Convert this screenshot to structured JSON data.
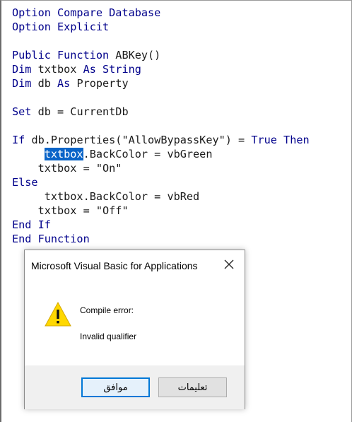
{
  "editor": {
    "lines": {
      "l1": {
        "kw1": "Option Compare Database"
      },
      "l2": {
        "kw1": "Option Explicit"
      },
      "l4": {
        "kw1": "Public Function",
        "rest": " ABKey()"
      },
      "l5": {
        "kw1": "Dim",
        "mid": " txtbox ",
        "kw2": "As String"
      },
      "l6": {
        "kw1": "Dim",
        "mid": " db ",
        "kw2": "As",
        "rest": " Property"
      },
      "l8": {
        "kw1": "Set",
        "rest": " db = CurrentDb"
      },
      "l10": {
        "kw1": "If",
        "mid": " db.Properties(\"AllowBypassKey\") = ",
        "kw2": "True Then"
      },
      "l11": {
        "indent": "     ",
        "sel": "txtbox",
        "rest": ".BackColor = vbGreen"
      },
      "l12": {
        "text": "    txtbox = \"On\""
      },
      "l13": {
        "kw1": "Else"
      },
      "l14": {
        "text": "     txtbox.BackColor = vbRed"
      },
      "l15": {
        "text": "    txtbox = \"Off\""
      },
      "l16": {
        "kw1": "End If"
      },
      "l17": {
        "kw1": "End Function"
      }
    }
  },
  "dialog": {
    "title": "Microsoft Visual Basic for Applications",
    "message_title": "Compile error:",
    "message_detail": "Invalid qualifier",
    "ok_label": "موافق",
    "help_label": "تعليمات",
    "close_icon": "close-icon",
    "warning_icon": "warning-icon"
  }
}
